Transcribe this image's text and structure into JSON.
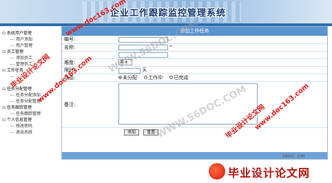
{
  "header": {
    "title": "企业工作跟踪监控管理系统"
  },
  "sidebar": {
    "groups": [
      {
        "label": "系统用户管理",
        "items": [
          "用户添加",
          "用户管理"
        ]
      },
      {
        "label": "员工管理",
        "items": [
          "添加员工",
          "管理员工"
        ]
      },
      {
        "label": "工作任务",
        "items": []
      },
      {
        "label": "任务分配管理",
        "items": [
          "任务分配添加",
          "任务分配管理"
        ]
      },
      {
        "label": "任务跟踪管理",
        "items": [
          "任务跟踪管理"
        ]
      },
      {
        "label": "个人信息管理",
        "items": [
          "修改密码"
        ]
      },
      {
        "label": "退出系统",
        "items": []
      }
    ]
  },
  "panel": {
    "title": "添加工作任务"
  },
  "form": {
    "number_label": "编号:",
    "name_label": "名称:",
    "name_req": "*",
    "level_label": "难度:",
    "level_value": "易",
    "duration_label": "限时:",
    "duration_unit": "天",
    "status_label": "状态:",
    "status_options": [
      "未分配",
      "工作中",
      "已完成"
    ],
    "note_label": "备注:",
    "add_button": "添加",
    "reset_button": "重置"
  },
  "watermarks": {
    "red1": "毕业设计论文网",
    "red2": "www.doc163.com",
    "gray1": "WWW.56DOC.COM",
    "site": "56DOC.COM",
    "brand": "毕业设计论文网"
  },
  "colors": {
    "accent": "#5a93cf",
    "watermark_red": "#e0211a",
    "title": "#17366d"
  }
}
